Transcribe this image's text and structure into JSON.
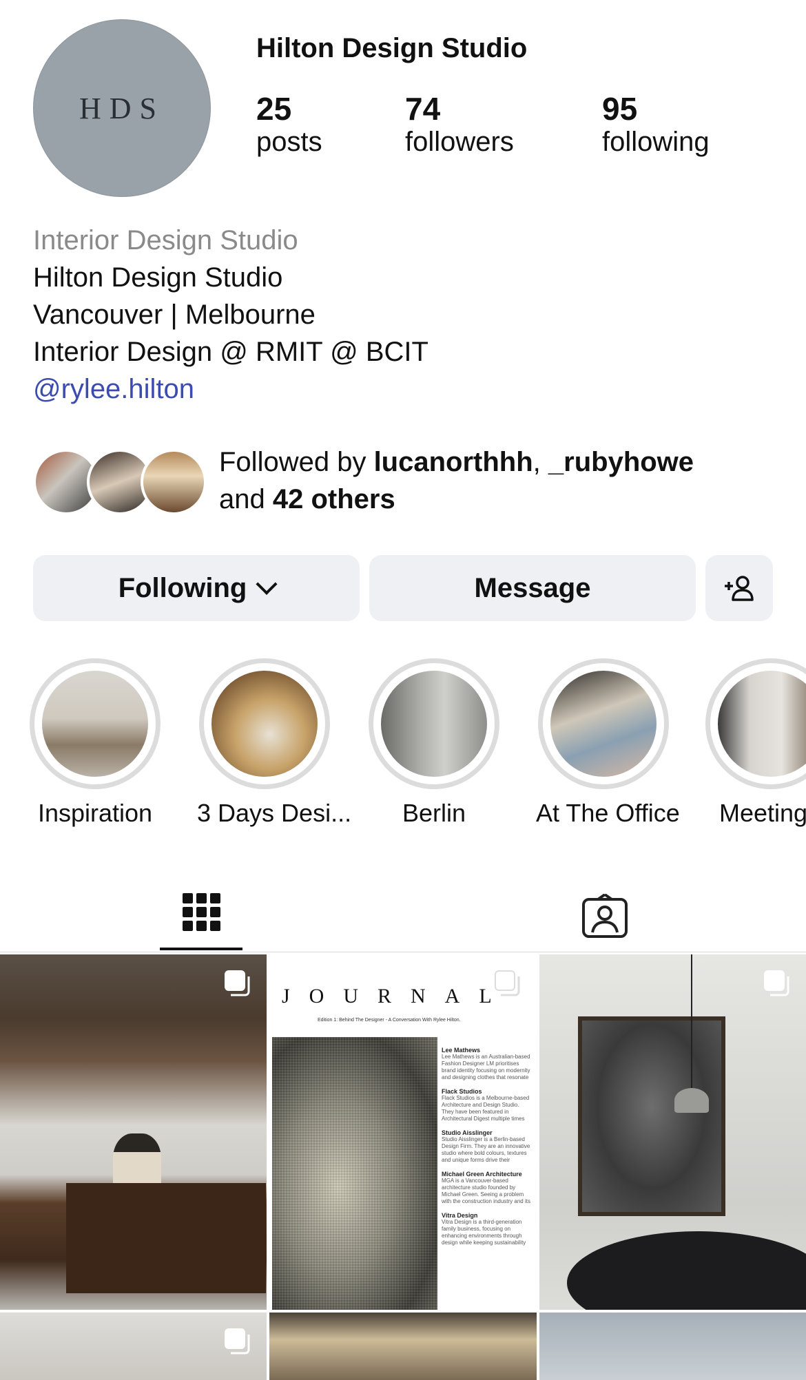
{
  "profile": {
    "avatar_initials": "HDS",
    "username": "Hilton Design Studio",
    "stats": {
      "posts": {
        "value": "25",
        "label": "posts"
      },
      "followers": {
        "value": "74",
        "label": "followers"
      },
      "following": {
        "value": "95",
        "label": "following"
      }
    },
    "bio": {
      "category": "Interior Design Studio",
      "line1": "Hilton Design Studio",
      "line2": "Vancouver | Melbourne",
      "line3": "Interior Design @ RMIT @ BCIT",
      "link": "@rylee.hilton"
    },
    "followed_by": {
      "prefix": "Followed by ",
      "user1": "lucanorthhh",
      "separator": ", ",
      "user2": "_rubyhowe",
      "middle": "and ",
      "others": "42 others"
    }
  },
  "actions": {
    "following_label": "Following",
    "message_label": "Message",
    "add_user_icon": "add-person-icon"
  },
  "highlights": [
    {
      "label": "Inspiration"
    },
    {
      "label": "3 Days Desi..."
    },
    {
      "label": "Berlin"
    },
    {
      "label": "At The Office"
    },
    {
      "label": "Meeting"
    }
  ],
  "tabs": {
    "grid_icon": "grid-icon",
    "tagged_icon": "tagged-icon"
  },
  "posts": {
    "journal": {
      "title": "JOURNAL",
      "subtitle": "Edition 1: Behind The Designer - A Conversation With Rylee Hilton.",
      "sections": [
        {
          "heading": "Lee Mathews",
          "text": "Lee Mathews is an Australian-based Fashion Designer LM prioritises brand identity focusing on modernity and designing clothes that resonate deeply with people's lives."
        },
        {
          "heading": "Flack Studios",
          "text": "Flack Studios is a Melbourne-based Architecture and Design Studio. They have been featured in Architectural Digest multiple times and prioritise multidisciplinary work within their studio."
        },
        {
          "heading": "Studio Aisslinger",
          "text": "Studio Aisslinger is a Berlin-based Design Firm. They are an innovative studio where bold colours, textures and unique forms drive their designs."
        },
        {
          "heading": "Michael Green Architecture",
          "text": "MGA is a Vancouver-based architecture studio founded by Michael Green. Seeing a problem with the construction industry and its impact on the planet."
        },
        {
          "heading": "Vitra Design",
          "text": "Vitra Design is a third-generation family business, focusing on enhancing environments through design while keeping sustainability at the forefront."
        }
      ]
    }
  },
  "colors": {
    "link": "#3c4bb0",
    "muted": "#8a8a8a",
    "button_bg": "#eef0f3",
    "avatar_bg": "#9aa2a9"
  }
}
